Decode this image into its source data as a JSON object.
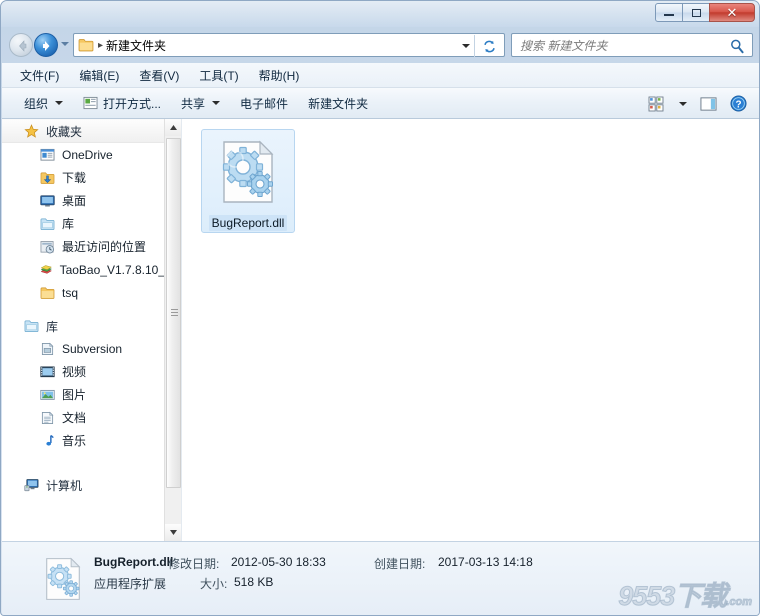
{
  "window": {
    "title": "",
    "buttons": {
      "minimize": "—",
      "maximize": "❐",
      "close": "✕"
    }
  },
  "navigation": {
    "back_label": "后退",
    "forward_label": "前进",
    "recent_dropdown_label": "最近浏览的位置",
    "breadcrumb_folder": "新建文件夹",
    "breadcrumb_separator": "▸",
    "address_dropdown_label": "以前的位置",
    "refresh_label": "刷新"
  },
  "search": {
    "placeholder": "搜索 新建文件夹",
    "value": "",
    "icon": "search-icon"
  },
  "menubar": {
    "items": [
      {
        "label": "文件(F)"
      },
      {
        "label": "编辑(E)"
      },
      {
        "label": "查看(V)"
      },
      {
        "label": "工具(T)"
      },
      {
        "label": "帮助(H)"
      }
    ]
  },
  "toolbar": {
    "organize_label": "组织",
    "openwith_label": "打开方式...",
    "share_label": "共享",
    "email_label": "电子邮件",
    "newfolder_label": "新建文件夹",
    "views_label": "更改您的视图",
    "preview_label": "显示预览窗格",
    "help_label": "获取帮助"
  },
  "sidebar": {
    "groups": [
      {
        "name": "收藏夹",
        "icon": "star-icon",
        "items": [
          {
            "label": "OneDrive",
            "icon": "onedrive-icon"
          },
          {
            "label": "下载",
            "icon": "downloads-icon"
          },
          {
            "label": "桌面",
            "icon": "desktop-icon"
          },
          {
            "label": "库",
            "icon": "library-folder-icon"
          },
          {
            "label": "最近访问的位置",
            "icon": "recent-places-icon"
          },
          {
            "label": "TaoBao_V1.7.8.10_",
            "icon": "books-icon"
          },
          {
            "label": "tsq",
            "icon": "folder-icon"
          }
        ]
      },
      {
        "name": "库",
        "icon": "library-icon",
        "items": [
          {
            "label": "Subversion",
            "icon": "subversion-icon"
          },
          {
            "label": "视频",
            "icon": "video-icon"
          },
          {
            "label": "图片",
            "icon": "pictures-icon"
          },
          {
            "label": "文档",
            "icon": "documents-icon"
          },
          {
            "label": "音乐",
            "icon": "music-icon"
          }
        ]
      },
      {
        "name": "计算机",
        "icon": "computer-icon",
        "items": []
      }
    ]
  },
  "files": [
    {
      "name": "BugReport.dll",
      "icon": "dll-gear-icon",
      "selected": true
    }
  ],
  "details": {
    "file_name": "BugReport.dll",
    "file_type": "应用程序扩展",
    "modified_label": "修改日期:",
    "modified_value": "2012-05-30 18:33",
    "size_label": "大小:",
    "size_value": "518 KB",
    "created_label": "创建日期:",
    "created_value": "2017-03-13 14:18",
    "icon": "dll-gear-icon"
  },
  "watermark": {
    "main": "9553",
    "suffix": "下载",
    "domain": ".com"
  },
  "colors": {
    "accent": "#2a7fd4",
    "close_button": "#c23b2e",
    "selection": "#cde3f7",
    "frame": "#c3d5e8"
  }
}
